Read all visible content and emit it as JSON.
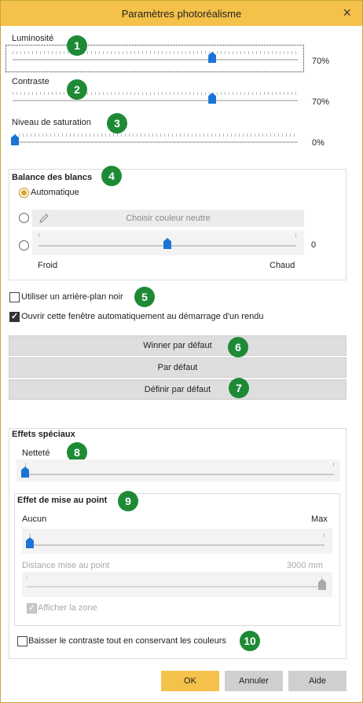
{
  "window": {
    "title": "Paramètres photoréalisme",
    "close_icon": "×"
  },
  "brightness": {
    "label": "Luminosité",
    "value_text": "70%",
    "value": 0.7
  },
  "contrast": {
    "label": "Contraste",
    "value_text": "70%",
    "value": 0.7
  },
  "saturation": {
    "label": "Niveau de saturation",
    "value_text": "0%",
    "value": 0.0
  },
  "white_balance": {
    "title": "Balance des blancs",
    "auto_label": "Automatique",
    "auto_selected": true,
    "choose_label": "Choisir couleur neutre",
    "slider_value_text": "0",
    "slider_value": 0.5,
    "left_label": "Froid",
    "right_label": "Chaud"
  },
  "options": {
    "black_background": "Utiliser un arrière-plan noir",
    "black_background_checked": false,
    "open_on_render": "Ouvrir cette fenêtre automatiquement au démarrage d'un rendu",
    "open_on_render_checked": true
  },
  "buttons": {
    "winner_default": "Winner par défaut",
    "default": "Par défaut",
    "set_default": "Définir par défaut"
  },
  "special_effects": {
    "title": "Effets spéciaux",
    "sharpness_label": "Netteté",
    "sharpness_value": 0.0,
    "focus_title": "Effet de mise au point",
    "focus_min_label": "Aucun",
    "focus_max_label": "Max",
    "focus_value": 0.0,
    "distance_label": "Distance mise au point",
    "distance_value_text": "3000 mm",
    "distance_value": 1.0,
    "show_zone_label": "Afficher la zone",
    "show_zone_checked": true,
    "lower_contrast_label": "Baisser le contraste tout en conservant les couleurs",
    "lower_contrast_checked": false
  },
  "footer": {
    "ok": "OK",
    "cancel": "Annuler",
    "help": "Aide"
  },
  "badges": [
    "1",
    "2",
    "3",
    "4",
    "5",
    "6",
    "7",
    "8",
    "9",
    "10"
  ],
  "colors": {
    "titlebar": "#f4c14a",
    "ok_button": "#f4c14a",
    "badge": "#1e8a36",
    "thumb": "#1a73d6"
  }
}
